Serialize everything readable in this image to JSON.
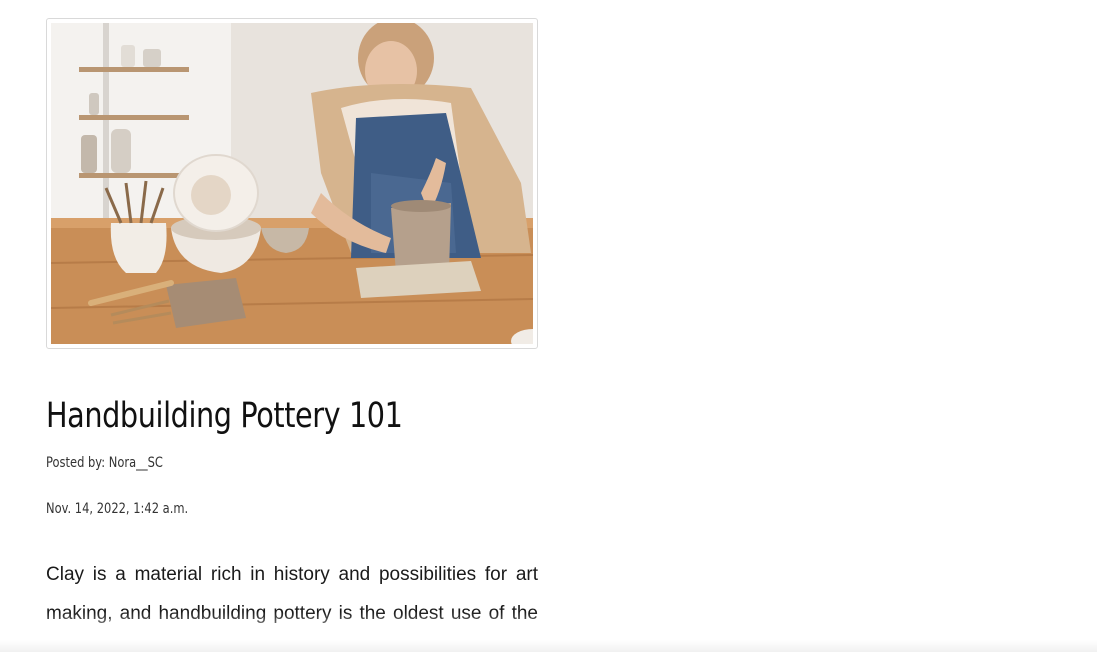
{
  "post": {
    "image_alt": "Woman handbuilding a clay pot at a wooden table",
    "title": "Handbuilding Pottery 101",
    "posted_by_label": "Posted by:",
    "author": "Nora__SC",
    "date": "Nov. 14, 2022, 1:42 a.m.",
    "body_line_1": "Clay is a material rich in history and possibilities for art",
    "body_line_2": "making, and handbuilding pottery is the oldest use of the"
  }
}
